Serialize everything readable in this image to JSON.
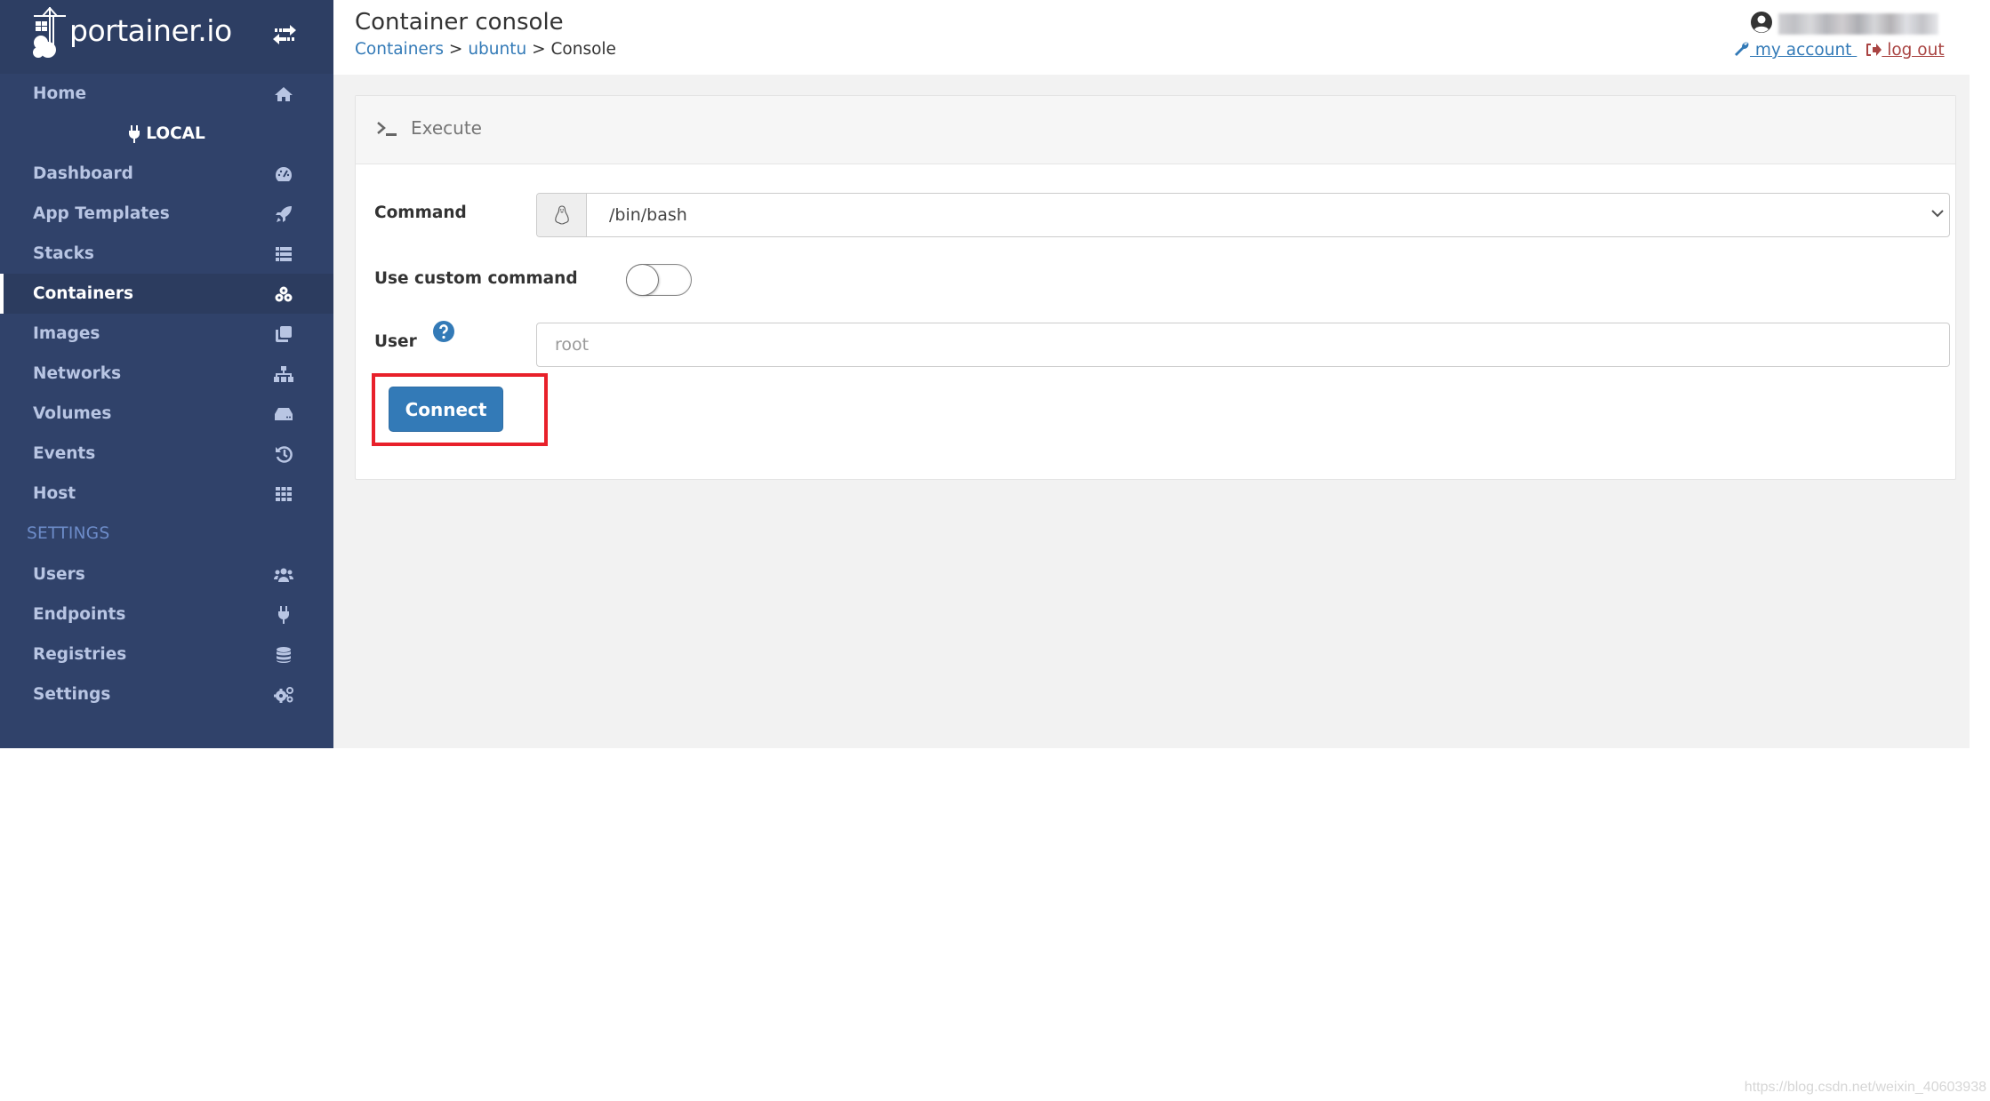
{
  "app": {
    "brand": "portainer.io"
  },
  "sidebar": {
    "home_label": "Home",
    "endpoint_label": "LOCAL",
    "items": [
      {
        "label": "Dashboard",
        "icon": "tachometer-icon"
      },
      {
        "label": "App Templates",
        "icon": "rocket-icon"
      },
      {
        "label": "Stacks",
        "icon": "th-list-icon"
      },
      {
        "label": "Containers",
        "icon": "cubes-icon",
        "active": true
      },
      {
        "label": "Images",
        "icon": "clone-icon"
      },
      {
        "label": "Networks",
        "icon": "sitemap-icon"
      },
      {
        "label": "Volumes",
        "icon": "hdd-icon"
      },
      {
        "label": "Events",
        "icon": "history-icon"
      },
      {
        "label": "Host",
        "icon": "th-icon"
      }
    ],
    "settings_section_label": "SETTINGS",
    "settings_items": [
      {
        "label": "Users",
        "icon": "users-icon"
      },
      {
        "label": "Endpoints",
        "icon": "plug-icon"
      },
      {
        "label": "Registries",
        "icon": "database-icon"
      },
      {
        "label": "Settings",
        "icon": "cogs-icon"
      }
    ]
  },
  "header": {
    "title": "Container console",
    "breadcrumb": [
      {
        "label": "Containers",
        "link": true
      },
      {
        "label": "ubuntu",
        "link": true
      },
      {
        "label": "Console",
        "link": false
      }
    ],
    "breadcrumb_separator": " > ",
    "my_account_label": " my account ",
    "logout_label": " log out"
  },
  "panel": {
    "title": "Execute",
    "command_label": "Command",
    "command_value": "/bin/bash",
    "custom_command_label": "Use custom command",
    "custom_command_enabled": false,
    "user_label": "User",
    "user_placeholder": "root",
    "user_value": "",
    "connect_label": "Connect"
  },
  "colors": {
    "sidebar_bg": "#30426a",
    "primary": "#337ab7",
    "danger": "#a94442",
    "highlight": "#e8202a"
  },
  "watermark": "https://blog.csdn.net/weixin_40603938"
}
